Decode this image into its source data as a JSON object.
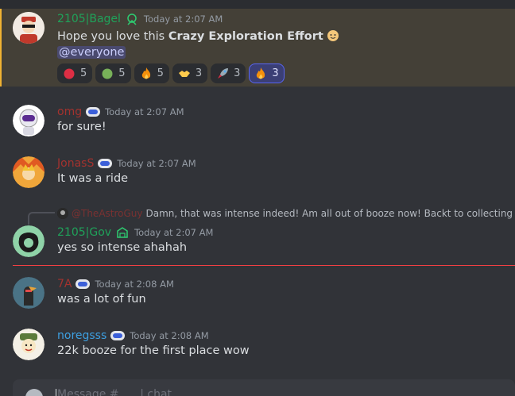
{
  "messages": {
    "m1": {
      "user": "2105|Bagel",
      "user_color": "#1fa25a",
      "time": "Today at 2:07 AM",
      "text_prefix": "Hope you love this ",
      "text_bold": "Crazy Exploration Effort",
      "mention": "@everyone",
      "reactions": [
        {
          "icon": "red-circle",
          "count": "5"
        },
        {
          "icon": "green-circle",
          "count": "5"
        },
        {
          "icon": "fire",
          "count": "5"
        },
        {
          "icon": "handshake",
          "count": "3"
        },
        {
          "icon": "rocket",
          "count": "3"
        },
        {
          "icon": "fire",
          "count": "3"
        }
      ]
    },
    "m2": {
      "user": "omg",
      "user_color": "#a3322e",
      "time": "Today at 2:07 AM",
      "text": "for sure!"
    },
    "m3": {
      "user": "JonasS",
      "user_color": "#a3322e",
      "time": "Today at 2:07 AM",
      "text": "It was a ride"
    },
    "m4": {
      "reply_user": "@TheAstroGuy",
      "reply_text": "Damn, that was intense indeed! Am all out of booze now! Backt to collecting",
      "user": "2105|Gov",
      "user_color": "#1fa25a",
      "time": "Today at 2:07 AM",
      "text": "yes so intense ahahah"
    },
    "m5": {
      "user": "7A",
      "user_color": "#a3322e",
      "time": "Today at 2:08 AM",
      "text": "was a lot of fun"
    },
    "m6": {
      "user": "noregsss",
      "user_color": "#3d9fe0",
      "time": "Today at 2:08 AM",
      "text": "22k booze for the first place wow"
    }
  },
  "composer": {
    "placeholder": "Message #      | chat"
  },
  "colors": {
    "accent_mention": "#f0b232",
    "new_divider": "#f23f43"
  }
}
